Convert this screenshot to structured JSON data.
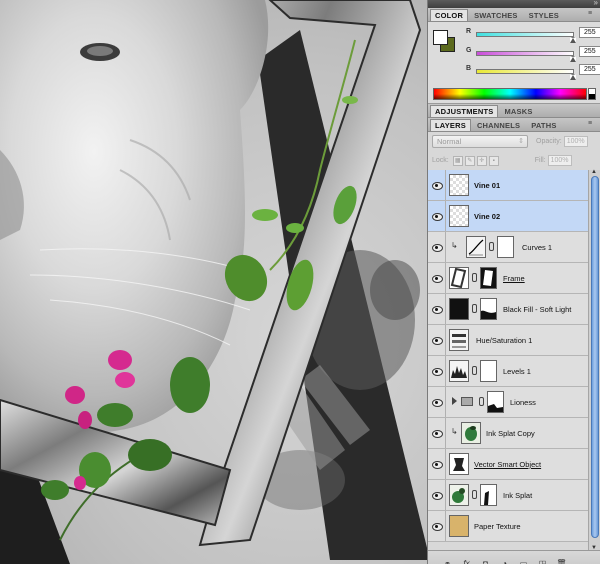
{
  "color_panel": {
    "tabs": [
      "COLOR",
      "SWATCHES",
      "STYLES"
    ],
    "active_tab": "COLOR",
    "foreground_color": "#ffffff",
    "background_color": "#5c6a1e",
    "channels": [
      {
        "label": "R",
        "value": "255",
        "level": 1.0,
        "track": "linear-gradient(to right,#00ffff,#ffffff)"
      },
      {
        "label": "G",
        "value": "255",
        "level": 1.0,
        "track": "linear-gradient(to right,#ff00ff,#ffffff)"
      },
      {
        "label": "B",
        "value": "255",
        "level": 1.0,
        "track": "linear-gradient(to right,#ffff00,#ffffff)"
      }
    ]
  },
  "adjustments_bar": {
    "tabs": [
      "ADJUSTMENTS",
      "MASKS"
    ],
    "active_tab": "ADJUSTMENTS"
  },
  "layers_panel": {
    "tabs": [
      "LAYERS",
      "CHANNELS",
      "PATHS"
    ],
    "active_tab": "LAYERS",
    "blend_mode": "Normal",
    "opacity_label": "Opacity:",
    "opacity_value": "100%",
    "lock_label": "Lock:",
    "fill_label": "Fill:",
    "fill_value": "100%",
    "layers": [
      {
        "name": "Vine 01",
        "selected": true,
        "bold": true,
        "underline": false,
        "type": "pixel",
        "thumb_icon": "vine-thumb"
      },
      {
        "name": "Vine 02",
        "selected": true,
        "bold": true,
        "underline": false,
        "type": "pixel",
        "thumb_icon": "vine-thumb"
      },
      {
        "name": "Curves 1",
        "selected": false,
        "bold": false,
        "underline": false,
        "type": "adjustment",
        "thumb_icon": "curves-icon"
      },
      {
        "name": "Frame",
        "selected": false,
        "bold": false,
        "underline": true,
        "type": "smart-masked",
        "thumb_icon": "frame-thumb"
      },
      {
        "name": "Black Fill - Soft Light",
        "selected": false,
        "bold": false,
        "underline": false,
        "type": "masked",
        "thumb_icon": "black-fill-thumb"
      },
      {
        "name": "Hue/Saturation 1",
        "selected": false,
        "bold": false,
        "underline": false,
        "type": "adjustment-nomask",
        "thumb_icon": "hue-saturation-icon"
      },
      {
        "name": "Levels 1",
        "selected": false,
        "bold": false,
        "underline": false,
        "type": "adjustment",
        "thumb_icon": "levels-icon"
      },
      {
        "name": "Lioness",
        "selected": false,
        "bold": false,
        "underline": false,
        "type": "group",
        "thumb_icon": "folder-icon"
      },
      {
        "name": "Ink Splat Copy",
        "selected": false,
        "bold": false,
        "underline": false,
        "type": "clipped",
        "thumb_icon": "ink-splat-thumb"
      },
      {
        "name": "Vector Smart Object",
        "selected": false,
        "bold": false,
        "underline": true,
        "type": "smart",
        "thumb_icon": "smart-object-thumb"
      },
      {
        "name": "Ink Splat",
        "selected": false,
        "bold": false,
        "underline": false,
        "type": "masked",
        "thumb_icon": "ink-splat-thumb"
      },
      {
        "name": "Paper Texture",
        "selected": false,
        "bold": false,
        "underline": false,
        "type": "pixel",
        "thumb_icon": "paper-thumb"
      }
    ],
    "footer_icons": [
      "link-layers-icon",
      "fx-icon",
      "add-mask-icon",
      "new-adjustment-icon",
      "new-group-icon",
      "new-layer-icon",
      "delete-layer-icon"
    ],
    "footer_glyphs": [
      "⚭",
      "fx",
      "◘",
      "◑",
      "▭",
      "◳",
      "🗑"
    ]
  }
}
